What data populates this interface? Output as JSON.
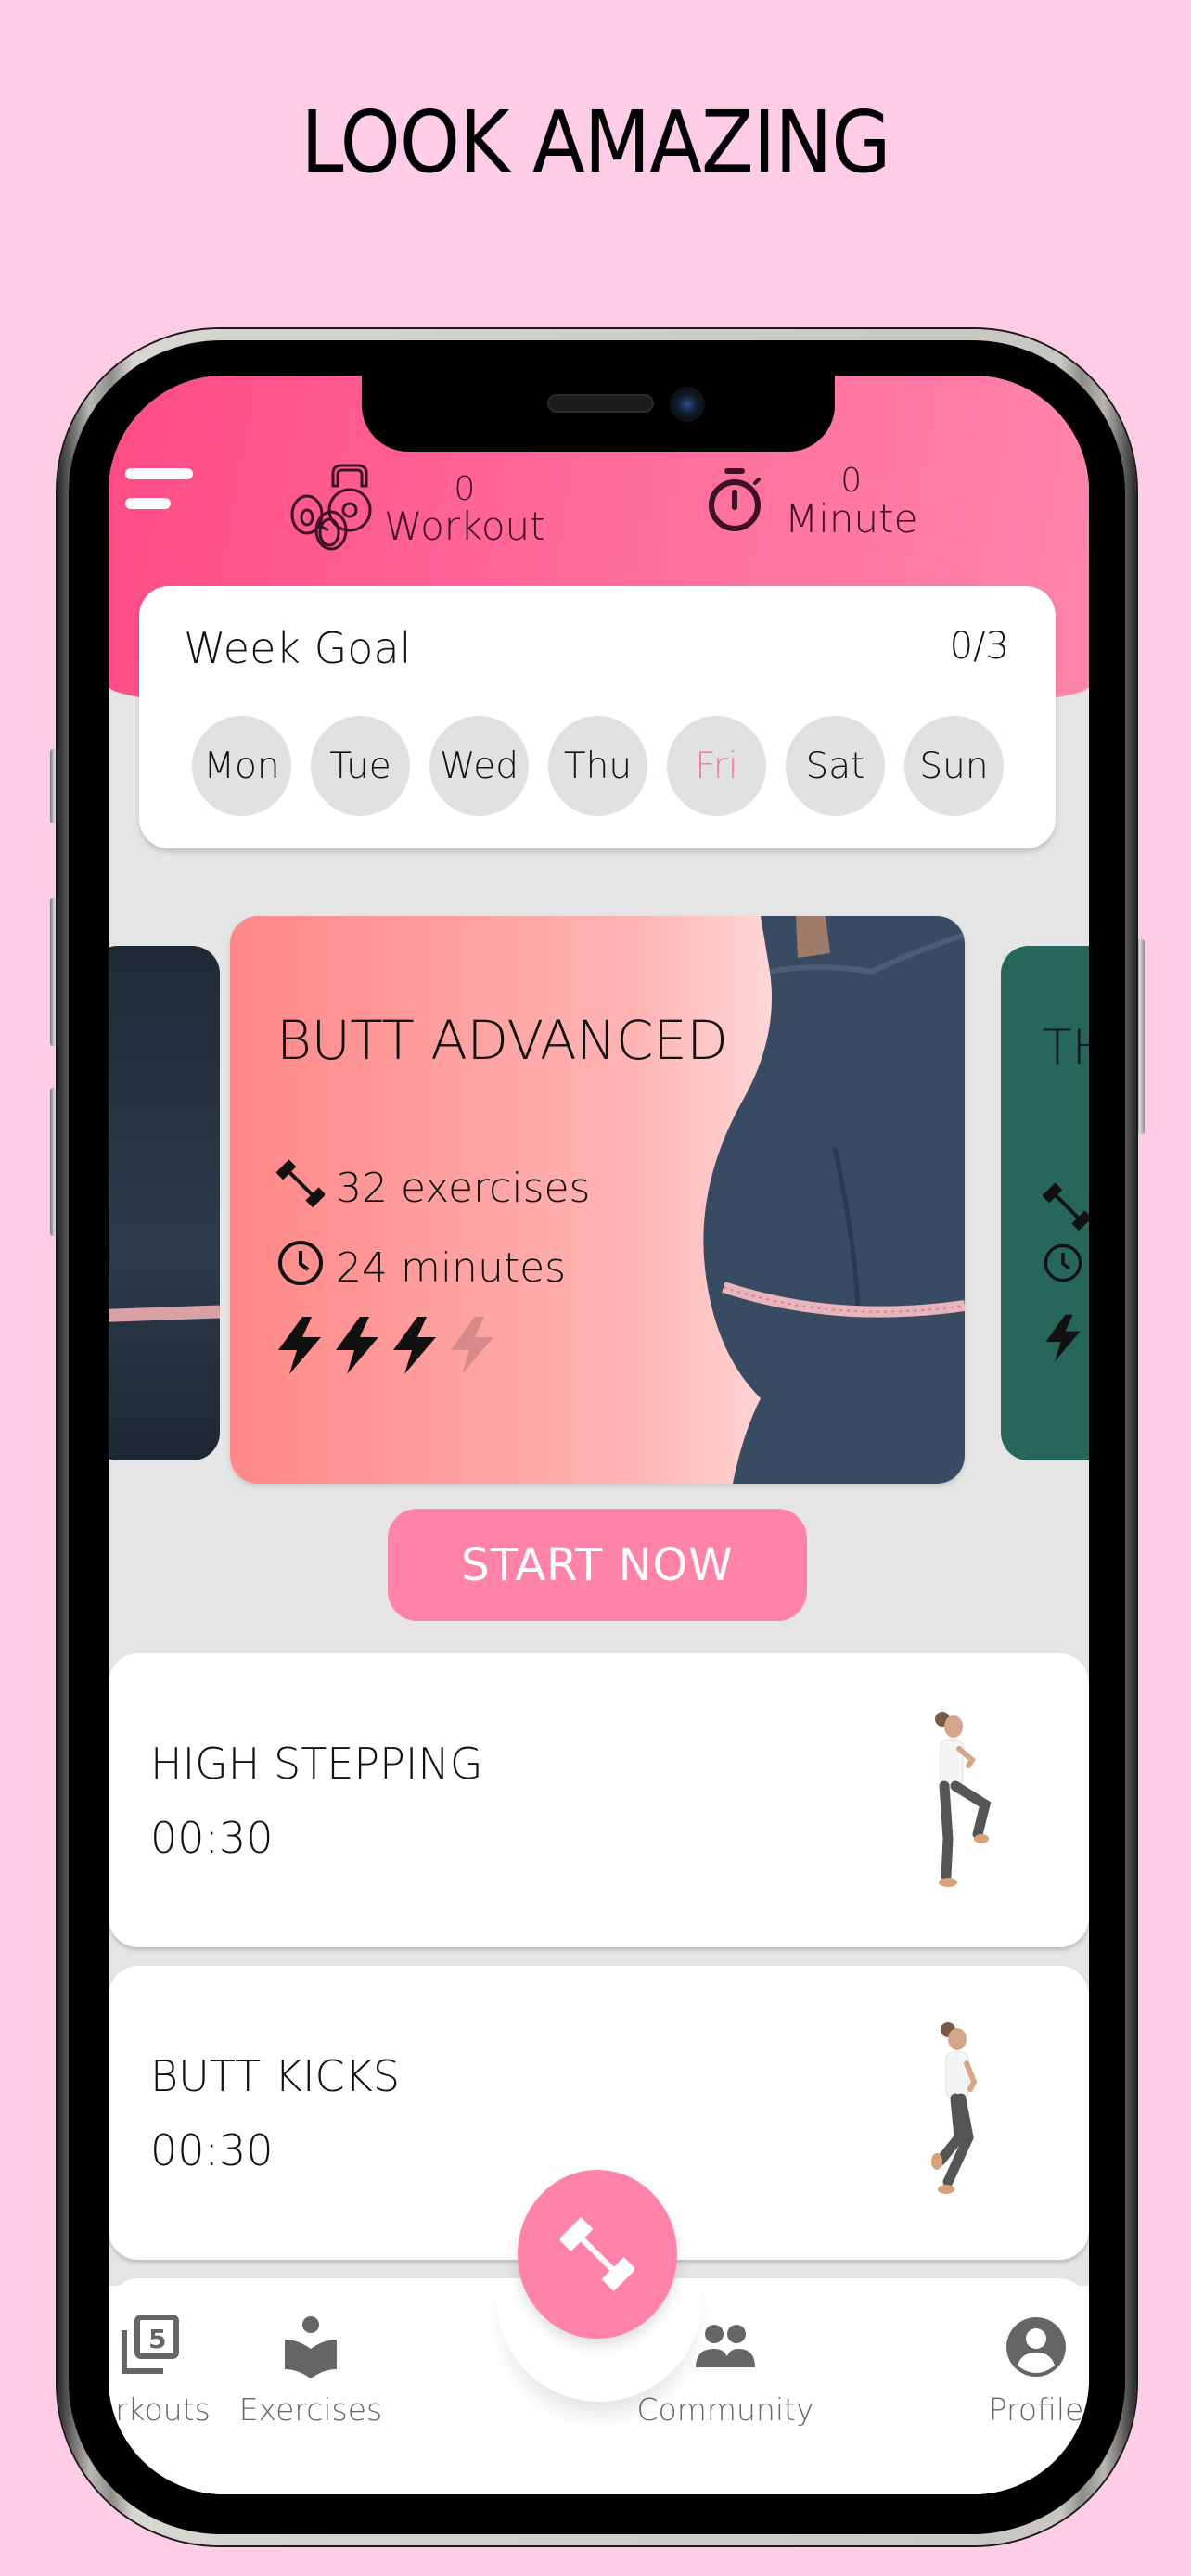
{
  "headline": "LOOK AMAZING",
  "header": {
    "menu_icon": "hamburger-menu-icon",
    "stats": [
      {
        "icon": "kettlebell-dumbbell-icon",
        "value": "0",
        "label": "Workout"
      },
      {
        "icon": "stopwatch-icon",
        "value": "0",
        "label": "Minute"
      }
    ]
  },
  "week_goal": {
    "title": "Week Goal",
    "progress": "0/3",
    "days": [
      {
        "label": "Mon",
        "active": false
      },
      {
        "label": "Tue",
        "active": false
      },
      {
        "label": "Wed",
        "active": false
      },
      {
        "label": "Thu",
        "active": false
      },
      {
        "label": "Fri",
        "active": true
      },
      {
        "label": "Sat",
        "active": false
      },
      {
        "label": "Sun",
        "active": false
      }
    ],
    "active_color": "#ee7ea8"
  },
  "carousel": {
    "featured": {
      "title": "BUTT ADVANCED",
      "exercises": "32 exercises",
      "duration": "24 minutes",
      "difficulty_level": 3,
      "difficulty_max": 4
    },
    "next_card_title_partial": "TH",
    "next_card_color": "#27675b"
  },
  "start_button": {
    "label": "START NOW",
    "color": "#ff82a9"
  },
  "exercises": [
    {
      "name": "HIGH STEPPING",
      "duration": "00:30"
    },
    {
      "name": "BUTT KICKS",
      "duration": "00:30"
    }
  ],
  "bottom_nav": {
    "items": [
      {
        "label": "Workouts",
        "icon": "workouts-icon"
      },
      {
        "label": "Exercises",
        "icon": "exercises-book-icon"
      },
      {
        "label": "Community",
        "icon": "community-icon"
      },
      {
        "label": "Profile",
        "icon": "profile-icon"
      }
    ],
    "fab_icon": "dumbbell-icon"
  },
  "colors": {
    "background": "#ffcce6",
    "header_start": "#ff4b85",
    "header_end": "#ff85ab",
    "accent": "#ff82a9"
  }
}
